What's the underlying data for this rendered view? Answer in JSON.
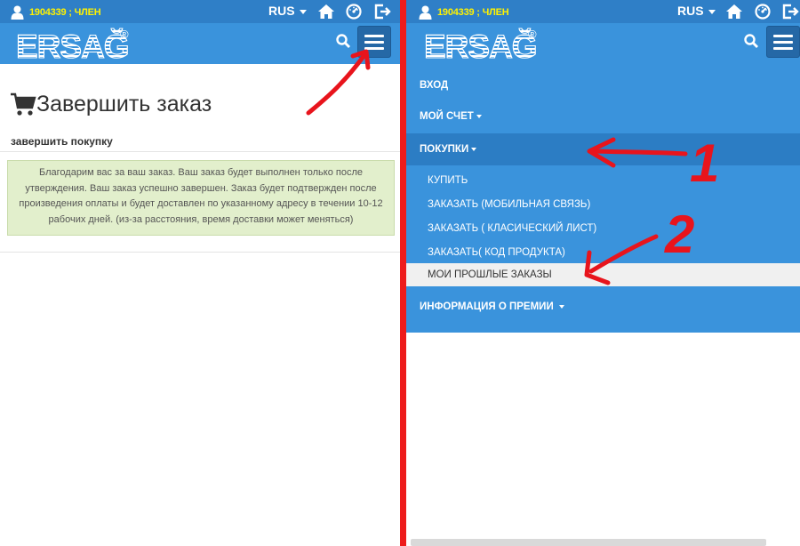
{
  "user": {
    "id_role": "1904339 ; ЧЛЕН"
  },
  "lang": {
    "label": "RUS"
  },
  "brand": {
    "name": "ERSAĞ",
    "registered": "®",
    "primary_color": "#3a93dc",
    "dark_color": "#2f7fc7",
    "user_color": "#fff200"
  },
  "icons": [
    "user-icon",
    "caret-down-icon",
    "home-icon",
    "dashboard-icon",
    "logout-icon",
    "search-icon",
    "menu-icon",
    "cart-icon"
  ],
  "left": {
    "title": "Завершить заказ",
    "subtitle": "завершить покупку",
    "alert_lines": [
      "Благодарим вас за ваш заказ. Ваш заказ будет выполнен только после",
      "утверждения. Ваш заказ успешно завершен. Заказ будет подтвержден после",
      "произведения оплаты и будет доставлен по указанному адресу в течении 10-12",
      "рабочих дней. (из-за расстояния, время доставки может меняться)"
    ]
  },
  "nav": {
    "login": "ВХОД",
    "account": "МОЙ СЧЕТ",
    "purchases": "ПОКУПКИ",
    "sub": [
      "КУПИТЬ",
      "ЗАКАЗАТЬ (МОБИЛЬНАЯ СВЯЗЬ)",
      "ЗАКАЗАТЬ ( КЛАСИЧЕСКИЙ ЛИСТ)",
      "ЗАКАЗАТЬ( КОД ПРОДУКТА)",
      "МОИ ПРОШЛЫЕ ЗАКАЗЫ"
    ],
    "bonus": "ИНФОРМАЦИЯ О ПРЕМИИ"
  },
  "annotations": {
    "one": "1",
    "two": "2"
  }
}
